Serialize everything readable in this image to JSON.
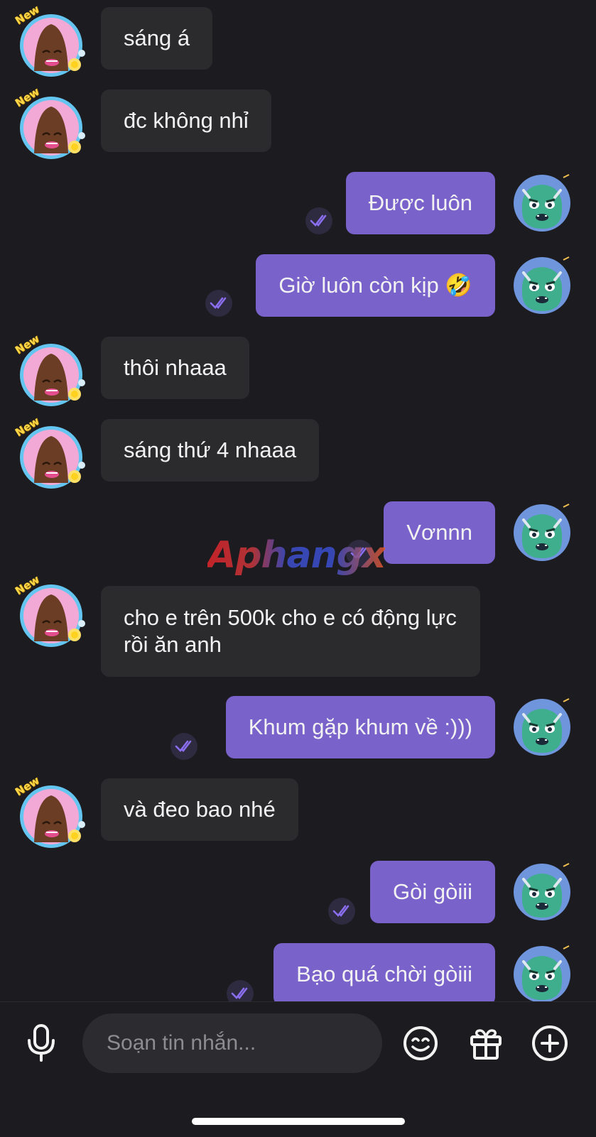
{
  "avatar_badge": "New",
  "watermark": "Aphangx",
  "colors": {
    "background": "#1c1b1f",
    "incoming_bubble": "#2b2b2e",
    "outgoing_bubble": "#7a62cb",
    "read_tick": "#8a6ef0"
  },
  "messages": [
    {
      "direction": "in",
      "text": "sáng á"
    },
    {
      "direction": "in",
      "text": "đc không nhỉ"
    },
    {
      "direction": "out",
      "text": "Được luôn",
      "status": "read"
    },
    {
      "direction": "out",
      "text": "Giờ luôn còn kịp 🤣",
      "status": "read"
    },
    {
      "direction": "in",
      "text": "thôi nhaaa"
    },
    {
      "direction": "in",
      "text": "sáng thứ 4 nhaaa"
    },
    {
      "direction": "out",
      "text": "Vơnnn",
      "status": "read"
    },
    {
      "direction": "in",
      "text": "cho e trên 500k cho e có động lực rồi ăn anh"
    },
    {
      "direction": "out",
      "text": "Khum gặp khum về :)))",
      "status": "read"
    },
    {
      "direction": "in",
      "text": "và đeo bao nhé"
    },
    {
      "direction": "out",
      "text": "Gòi gòiii",
      "status": "read"
    },
    {
      "direction": "out",
      "text": "Bạo quá chời gòiii",
      "status": "read"
    }
  ],
  "composer": {
    "placeholder": "Soạn tin nhắn...",
    "icons": [
      "microphone-icon",
      "emoji-icon",
      "gift-icon",
      "add-circle-icon"
    ]
  }
}
